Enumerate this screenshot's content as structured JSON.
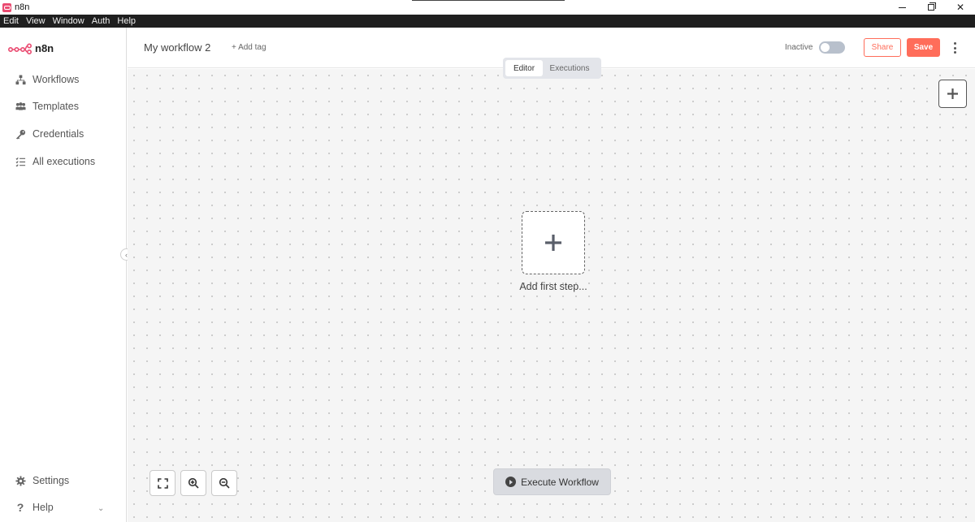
{
  "window": {
    "title": "n8n",
    "controls": {
      "minimize": "minimize-icon",
      "maximize": "maximize-icon",
      "close": "✕"
    }
  },
  "menubar": {
    "items": [
      "Edit",
      "View",
      "Window",
      "Auth",
      "Help"
    ]
  },
  "sidebar": {
    "logo_text": "n8n",
    "items": [
      {
        "label": "Workflows",
        "icon": "workflows-icon"
      },
      {
        "label": "Templates",
        "icon": "templates-icon"
      },
      {
        "label": "Credentials",
        "icon": "key-icon"
      },
      {
        "label": "All executions",
        "icon": "list-icon"
      }
    ],
    "bottom_items": [
      {
        "label": "Settings",
        "icon": "gear-icon"
      },
      {
        "label": "Help",
        "icon": "question-icon"
      }
    ],
    "collapse_glyph": "‹",
    "help_chevron": "⌄"
  },
  "header": {
    "workflow_name": "My workflow 2",
    "add_tag": "+ Add tag",
    "status_label": "Inactive",
    "active": false,
    "share_label": "Share",
    "save_label": "Save"
  },
  "tabs": {
    "items": [
      "Editor",
      "Executions"
    ],
    "selected": "Editor"
  },
  "canvas": {
    "add_first_step_label": "Add first step...",
    "execute_label": "Execute Workflow"
  },
  "colors": {
    "accent": "#ff6d5a",
    "logo": "#ea4b71",
    "canvas_bg": "#f5f5f5"
  }
}
